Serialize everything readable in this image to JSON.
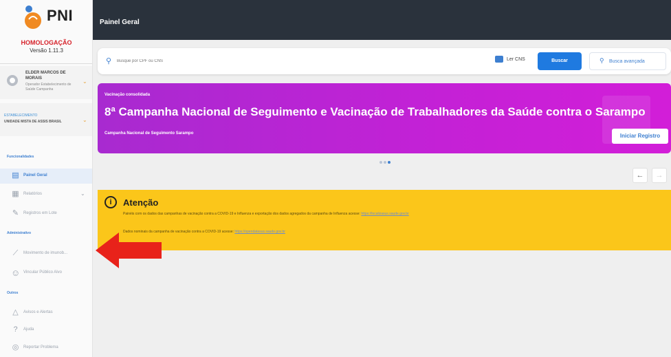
{
  "app": {
    "logo_text": "PNI",
    "environment": "HOMOLOGAÇÃO",
    "version": "Versão 1.11.3"
  },
  "user": {
    "name": "ELDER MARCOS DE MORAIS",
    "role": "Operador Estabelecimento de Saúde Campanha"
  },
  "establishment": {
    "label": "ESTABELECIMENTO",
    "name": "UNIDADE MISTA DE ASSIS BRASIL"
  },
  "sidebar": {
    "section_funcionalidades": "Funcionalidades",
    "section_administrativo": "Administrativo",
    "section_outros": "Outros",
    "items": [
      {
        "label": "Painel Geral",
        "icon": "dashboard-icon"
      },
      {
        "label": "Relatórios",
        "icon": "report-icon"
      },
      {
        "label": "Registros em Lote",
        "icon": "pencil-icon"
      },
      {
        "label": "Movimento de imunob...",
        "icon": "syringe-icon"
      },
      {
        "label": "Vincular Público Alvo",
        "icon": "person-icon"
      },
      {
        "label": "Avisos e Alertas",
        "icon": "bell-icon"
      },
      {
        "label": "Ajuda",
        "icon": "help-icon"
      },
      {
        "label": "Reportar Problema",
        "icon": "report-problem-icon"
      }
    ]
  },
  "header": {
    "title": "Painel Geral"
  },
  "search": {
    "placeholder": "Busque por CPF ou CNS",
    "ler_cns_label": "Ler CNS",
    "buscar_label": "Buscar",
    "busca_avancada_label": "Busca avançada"
  },
  "banner": {
    "kicker": "Vacinação consolidada",
    "title": "8ª Campanha Nacional de Seguimento e Vacinação de Trabalhadores da Saúde contra o Sarampo",
    "subtitle": "Campanha Nacional de Seguimento Sarampo",
    "button_label": "Iniciar Registro",
    "color": "#c421d6"
  },
  "carousel": {
    "prev": "←",
    "next": "→"
  },
  "alert": {
    "title": "Atenção",
    "line1": "Painéis com os dados das campanhas de vacinação contra a COVID-19 e Influenza e exportação dos dados agregados da campanha de Influenza acesse:",
    "line1_link": "https://localizasus.saude.gov.br",
    "line2": "Dados nominais da campanha de vacinação contra a COVID-19 acesse:",
    "line2_link": "https://opendatasus.saude.gov.br",
    "color": "#fbc61a"
  },
  "annotation": {
    "arrow_color": "#e8221a"
  }
}
